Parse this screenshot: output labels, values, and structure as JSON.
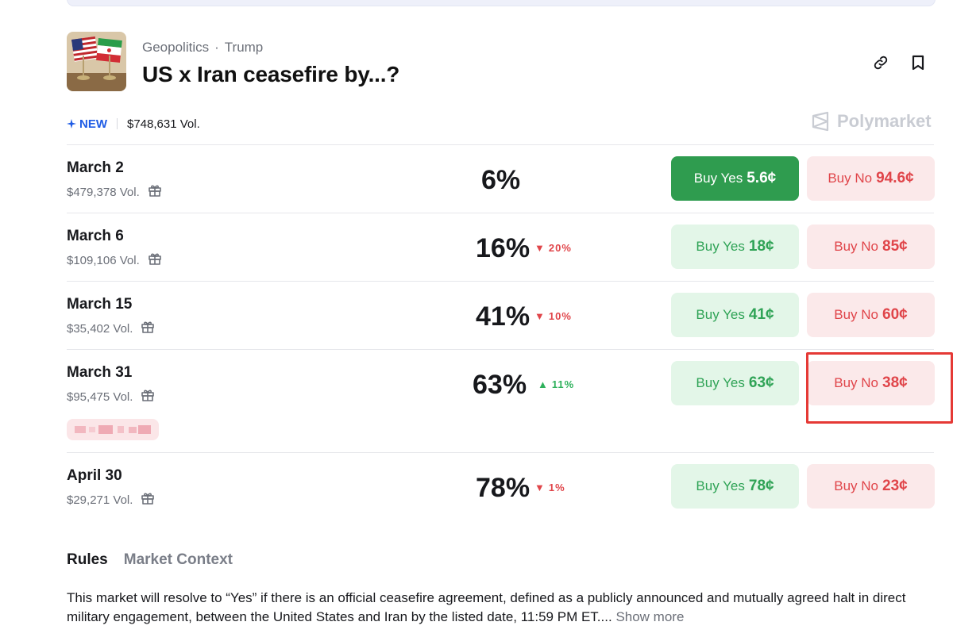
{
  "header": {
    "category": "Geopolitics",
    "subcategory": "Trump",
    "title": "US x Iran ceasefire by...?"
  },
  "meta": {
    "new_label": "NEW",
    "total_volume": "$748,631 Vol.",
    "brand": "Polymarket"
  },
  "icons": {
    "link": "link-icon",
    "bookmark": "bookmark-icon",
    "gift": "gift-icon",
    "sparkle": "sparkle-icon",
    "brand": "polymarket-logo-icon"
  },
  "colors": {
    "yes_active": "#2f9c4f",
    "yes_bg": "#e3f6e8",
    "no_bg": "#fbe9ea",
    "no_text": "#e0454a",
    "up": "#2fb15c",
    "new_badge": "#1f5ce5",
    "highlight_box": "#e53935"
  },
  "markets": [
    {
      "label": "March 2",
      "volume": "$479,378 Vol.",
      "percent": "6%",
      "change": "",
      "direction": "",
      "yes_label": "Buy Yes",
      "yes_price": "5.6¢",
      "no_label": "Buy No",
      "no_price": "94.6¢"
    },
    {
      "label": "March 6",
      "volume": "$109,106 Vol.",
      "percent": "16%",
      "change": "20%",
      "direction": "down",
      "yes_label": "Buy Yes",
      "yes_price": "18¢",
      "no_label": "Buy No",
      "no_price": "85¢"
    },
    {
      "label": "March 15",
      "volume": "$35,402 Vol.",
      "percent": "41%",
      "change": "10%",
      "direction": "down",
      "yes_label": "Buy Yes",
      "yes_price": "41¢",
      "no_label": "Buy No",
      "no_price": "60¢"
    },
    {
      "label": "March 31",
      "volume": "$95,475 Vol.",
      "percent": "63%",
      "change": "11%",
      "direction": "up",
      "yes_label": "Buy Yes",
      "yes_price": "63¢",
      "no_label": "Buy No",
      "no_price": "38¢"
    },
    {
      "label": "April 30",
      "volume": "$29,271 Vol.",
      "percent": "78%",
      "change": "1%",
      "direction": "down",
      "yes_label": "Buy Yes",
      "yes_price": "78¢",
      "no_label": "Buy No",
      "no_price": "23¢"
    }
  ],
  "tabs": [
    "Rules",
    "Market Context"
  ],
  "rules": {
    "text": "This market will resolve to “Yes” if there is an official ceasefire agreement, defined as a publicly announced and mutually agreed halt in direct military engagement, between the United States and Iran by the listed date, 11:59 PM ET....",
    "show_more": "Show more"
  }
}
